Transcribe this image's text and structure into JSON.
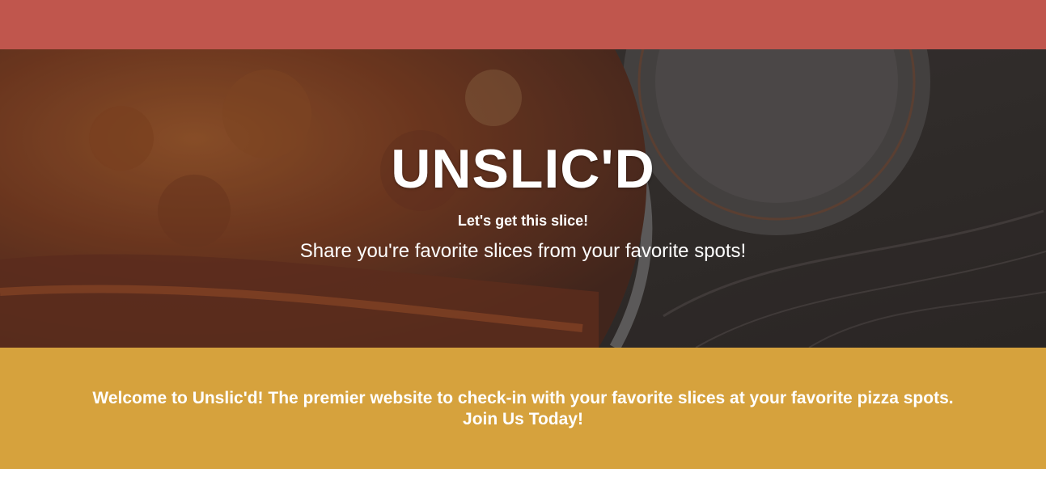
{
  "colors": {
    "topbar": "#c0564d",
    "welcome_band": "#d6a23d",
    "text": "#ffffff"
  },
  "hero": {
    "title": "UNSLIC'D",
    "tagline": "Let's get this slice!",
    "subtitle": "Share you're favorite slices from your favorite spots!",
    "background_image": "pizza-slice-photo"
  },
  "welcome": {
    "line1": "Welcome to Unslic'd! The premier website to check-in with your favorite slices at your favorite pizza spots.",
    "line2": "Join Us Today!"
  }
}
